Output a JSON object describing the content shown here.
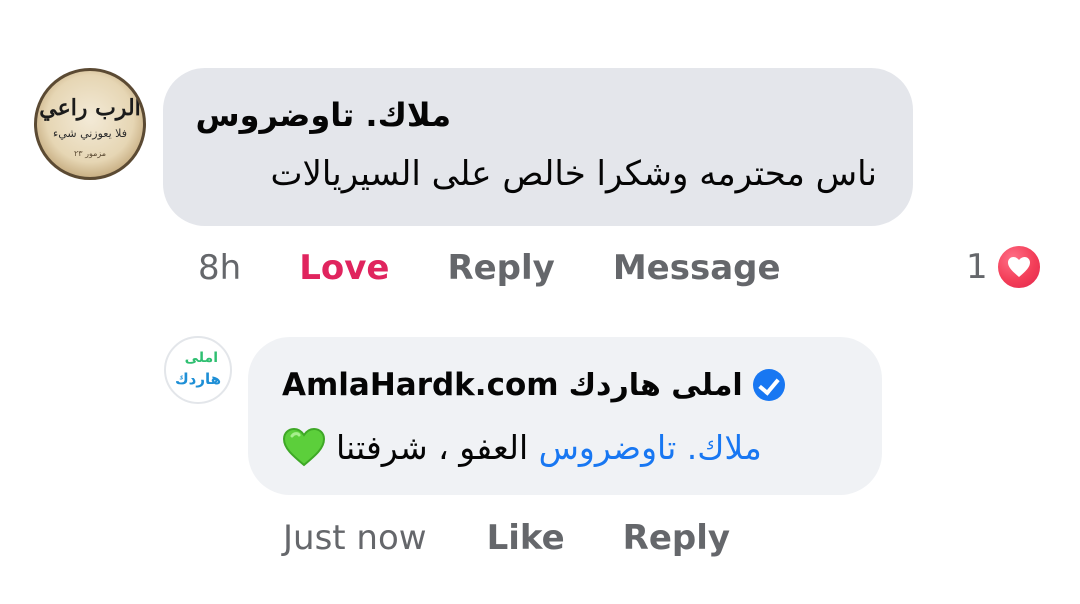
{
  "comment": {
    "avatar_logo_text": "الرب راعي",
    "avatar_logo_sub": "فلا يعوزني شيء",
    "avatar_logo_foot": "مزمور ٢٣",
    "author": "ملاك. تاوضروس",
    "text": "ناس محترمه وشكرا خالص على السيريالات",
    "time": "8h",
    "love_label": "Love",
    "reply_label": "Reply",
    "message_label": "Message",
    "reaction_count": "1",
    "reaction_icon": "love-heart-icon",
    "love_color": "#e0245e"
  },
  "reply": {
    "avatar_logo_top": "املى",
    "avatar_logo_bottom": "هاردك",
    "page_name": "املى هاردك",
    "page_domain": "AmlaHardk.com",
    "verified_icon": "verified-badge-icon",
    "mention": "ملاك. تاوضروس",
    "text": "العفو ، شرفتنا",
    "emoji": "green-heart-icon",
    "time": "Just now",
    "like_label": "Like",
    "reply_label": "Reply",
    "accent_color": "#1877f2"
  }
}
